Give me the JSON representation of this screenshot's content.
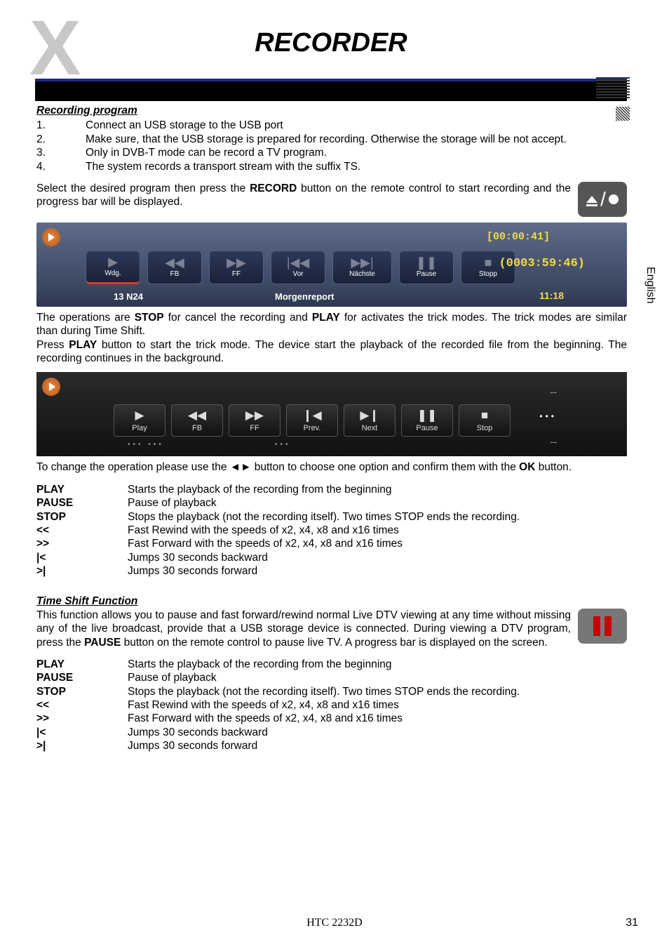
{
  "header": {
    "title": "RECORDER"
  },
  "sideTab": "English",
  "section1": {
    "heading": "Recording program",
    "list": [
      "Connect an USB storage to the USB port",
      "Make sure, that the USB storage is prepared for recording. Otherwise the storage will be not accept.",
      "Only in DVB-T mode can be record a TV program.",
      "The system records a transport stream with the suffix TS."
    ],
    "startText_pre": "Select the desired program then press the ",
    "startText_bold": "RECORD",
    "startText_post": " button on the remote control to start recording and the progress bar will be displayed."
  },
  "osd1": {
    "buttons": [
      {
        "label": "Wdg.",
        "icon": "play"
      },
      {
        "label": "FB",
        "icon": "rw"
      },
      {
        "label": "FF",
        "icon": "ff"
      },
      {
        "label": "Vor",
        "icon": "prev"
      },
      {
        "label": "Nächste",
        "icon": "next"
      },
      {
        "label": "Pause",
        "icon": "pause"
      },
      {
        "label": "Stopp",
        "icon": "stop"
      }
    ],
    "timeElapsed": "[00:00:41]",
    "timeTotal": "(0003:59:46)",
    "clock": "11:18",
    "channel": "13 N24",
    "program": "Morgenreport"
  },
  "afterOsd1": {
    "pre1": "The operations are ",
    "b1": "STOP",
    "mid1": " for cancel the recording and ",
    "b2": "PLAY",
    "post1": " for activates the trick modes. The trick modes are similar than during Time Shift.",
    "pre2": "Press ",
    "b3": "PLAY",
    "post2": " button to start the trick mode. The device start the playback of the recorded file from the beginning. The recording continues in the background."
  },
  "osd2": {
    "buttons": [
      {
        "label": "Play",
        "icon": "play"
      },
      {
        "label": "FB",
        "icon": "rw"
      },
      {
        "label": "FF",
        "icon": "ff"
      },
      {
        "label": "Prev.",
        "icon": "prev"
      },
      {
        "label": "Next",
        "icon": "next"
      },
      {
        "label": "Pause",
        "icon": "pause"
      },
      {
        "label": "Stop",
        "icon": "stop"
      }
    ]
  },
  "afterOsd2": {
    "pre": "To change the operation please use the ◄► button to choose one option and confirm them with the ",
    "b": "OK",
    "post": " button."
  },
  "controls1": [
    {
      "k": "PLAY",
      "v": "Starts the playback of the recording from the beginning"
    },
    {
      "k": "PAUSE",
      "v": "Pause of playback"
    },
    {
      "k": "STOP",
      "v": "Stops the playback (not the recording itself). Two times STOP ends the recording."
    },
    {
      "k": "<<",
      "v": "Fast Rewind with the speeds of x2, x4, x8 and x16 times"
    },
    {
      "k": ">>",
      "v": "Fast Forward with the speeds of x2, x4, x8 and x16 times"
    },
    {
      "k": "|<",
      "v": "Jumps 30 seconds backward"
    },
    {
      "k": ">|",
      "v": "Jumps 30 seconds forward"
    }
  ],
  "section2": {
    "heading": "Time Shift Function",
    "pre": "This function allows you to pause and fast forward/rewind normal Live DTV viewing at any time without missing any of the live broadcast, provide that a USB storage device is connected. During viewing a DTV program, press the ",
    "b": "PAUSE",
    "post": " button on the remote control to pause live TV. A progress bar is displayed on the screen."
  },
  "controls2": [
    {
      "k": "PLAY",
      "v": "Starts the playback of the recording from the beginning"
    },
    {
      "k": "PAUSE",
      "v": "Pause of playback"
    },
    {
      "k": "STOP",
      "v": "Stops the playback (not the recording itself). Two times STOP ends the recording."
    },
    {
      "k": "<<",
      "v": "Fast Rewind with the speeds of x2, x4, x8 and x16 times"
    },
    {
      "k": ">>",
      "v": "Fast Forward with the speeds of x2, x4, x8 and x16 times"
    },
    {
      "k": "|<",
      "v": "Jumps 30 seconds backward"
    },
    {
      "k": ">|",
      "v": "Jumps 30 seconds forward"
    }
  ],
  "footer": {
    "model": "HTC 2232D",
    "page": "31"
  }
}
